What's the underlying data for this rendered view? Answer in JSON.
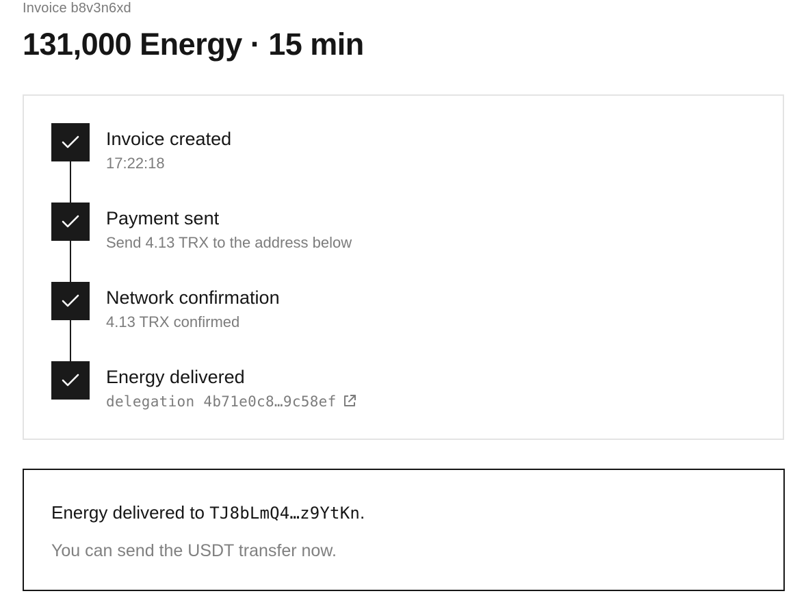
{
  "header": {
    "invoice_label": "Invoice b8v3n6xd",
    "title": "131,000 Energy · 15 min"
  },
  "steps": [
    {
      "title": "Invoice created",
      "subtitle": "17:22:18",
      "status": "done"
    },
    {
      "title": "Payment sent",
      "subtitle": "Send 4.13 TRX to the address below",
      "status": "done"
    },
    {
      "title": "Network confirmation",
      "subtitle": "4.13 TRX confirmed",
      "status": "done"
    },
    {
      "title": "Energy delivered",
      "subtitle_prefix": "delegation",
      "subtitle_hash": "4b71e0c8…9c58ef",
      "status": "done",
      "link_icon": "external-link-icon"
    }
  ],
  "notice": {
    "title_prefix": "Energy delivered to",
    "address": "TJ8bLmQ4…z9YtKn",
    "title_suffix": ".",
    "message": "You can send the USDT transfer now."
  },
  "colors": {
    "accent": "#1a1a1a",
    "muted_text": "#7c7c7c",
    "panel_border": "#e3e3e3"
  }
}
